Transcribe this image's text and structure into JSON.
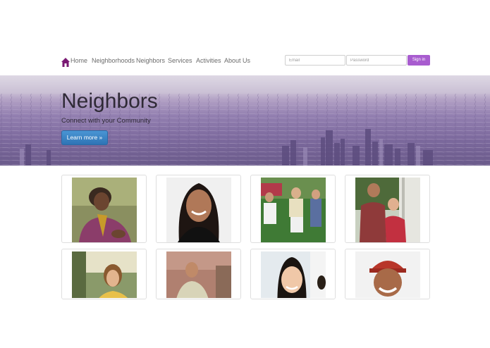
{
  "navbar": {
    "brand_icon": "house-icon",
    "links": [
      "Home",
      "Neighborhoods",
      "Neighbors",
      "Services",
      "Activities",
      "About Us"
    ]
  },
  "login": {
    "email_placeholder": "Email",
    "password_placeholder": "Password",
    "signin_label": "Sign in"
  },
  "hero": {
    "title": "Neighbors",
    "subtitle": "Connect with your Community",
    "button_label": "Learn more »"
  },
  "colors": {
    "accent": "#a85ccf",
    "button_blue": "#2e74b5",
    "hero_purple": "#8d7aae"
  },
  "grid": {
    "cards": [
      {
        "photo": "woman-scarf-photo"
      },
      {
        "photo": "smiling-woman-photo"
      },
      {
        "photo": "group-lawn-chairs-photo"
      },
      {
        "photo": "couple-porch-photo"
      },
      {
        "photo": "woman-park-photo"
      },
      {
        "photo": "man-street-photo"
      },
      {
        "photo": "young-woman-photo"
      },
      {
        "photo": "man-red-cap-photo"
      }
    ]
  }
}
